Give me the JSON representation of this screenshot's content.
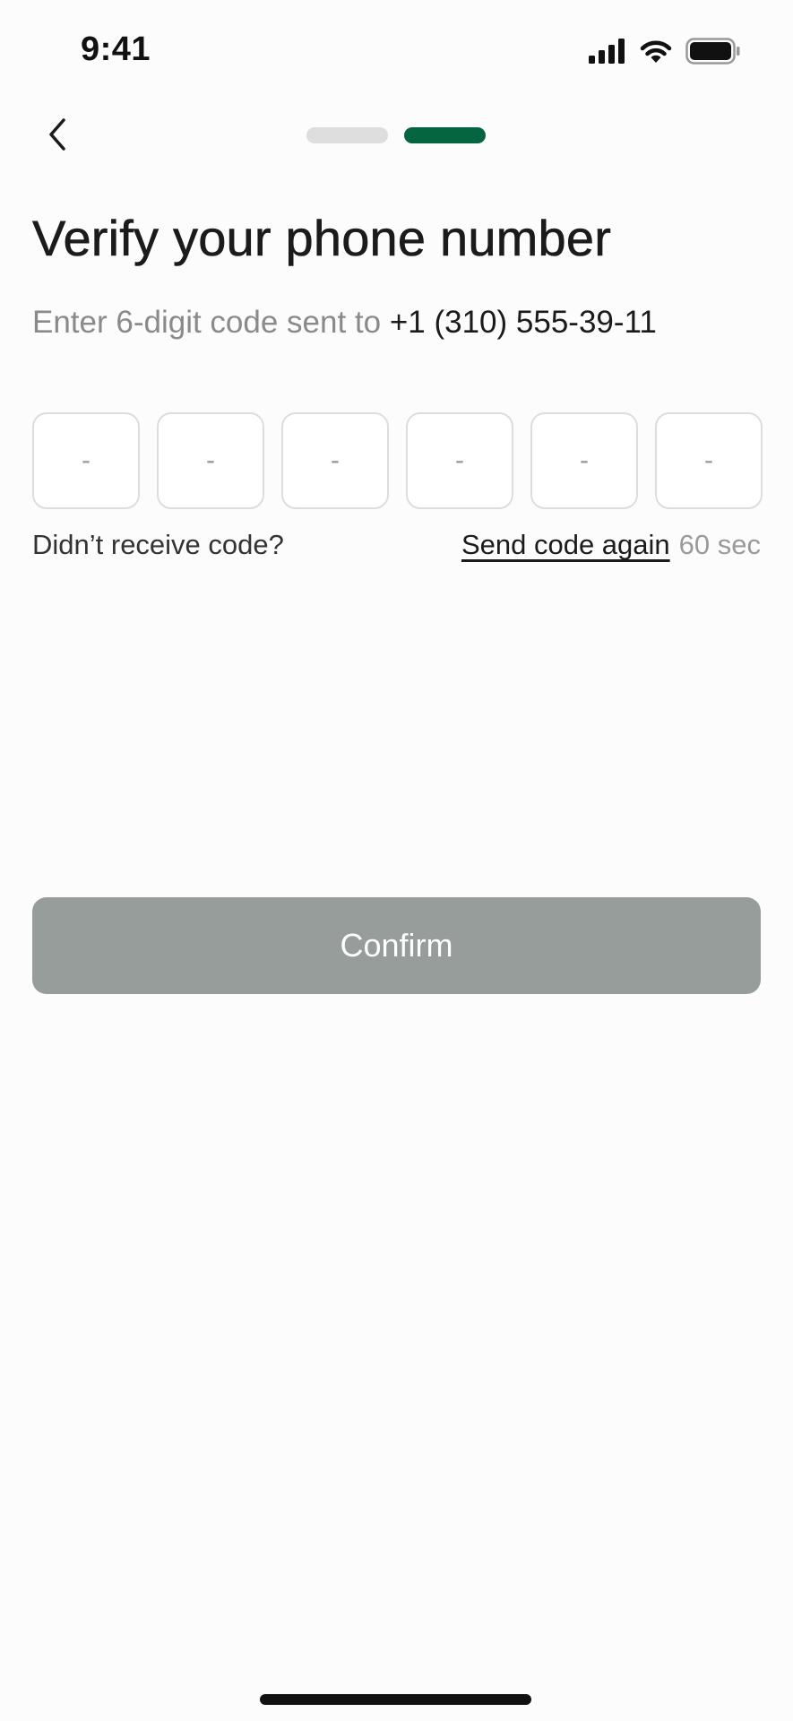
{
  "status_bar": {
    "time": "9:41",
    "icons": [
      "cellular-signal-icon",
      "wifi-icon",
      "battery-icon"
    ]
  },
  "nav": {
    "back_icon": "chevron-left-icon",
    "progress": {
      "total_steps": 2,
      "current_step": 2
    }
  },
  "title": "Verify your phone number",
  "subtitle": {
    "prefix": "Enter 6-digit code sent to ",
    "phone": "+1 (310) 555-39-11"
  },
  "code_inputs": [
    {
      "placeholder": "-"
    },
    {
      "placeholder": "-"
    },
    {
      "placeholder": "-"
    },
    {
      "placeholder": "-"
    },
    {
      "placeholder": "-"
    },
    {
      "placeholder": "-"
    }
  ],
  "resend": {
    "prompt": "Didn’t receive code?",
    "link": "Send code again",
    "countdown": "60 sec"
  },
  "confirm_label": "Confirm",
  "colors": {
    "accent": "#056540",
    "progress_inactive": "#dedede",
    "button_disabled": "#969d9a"
  }
}
